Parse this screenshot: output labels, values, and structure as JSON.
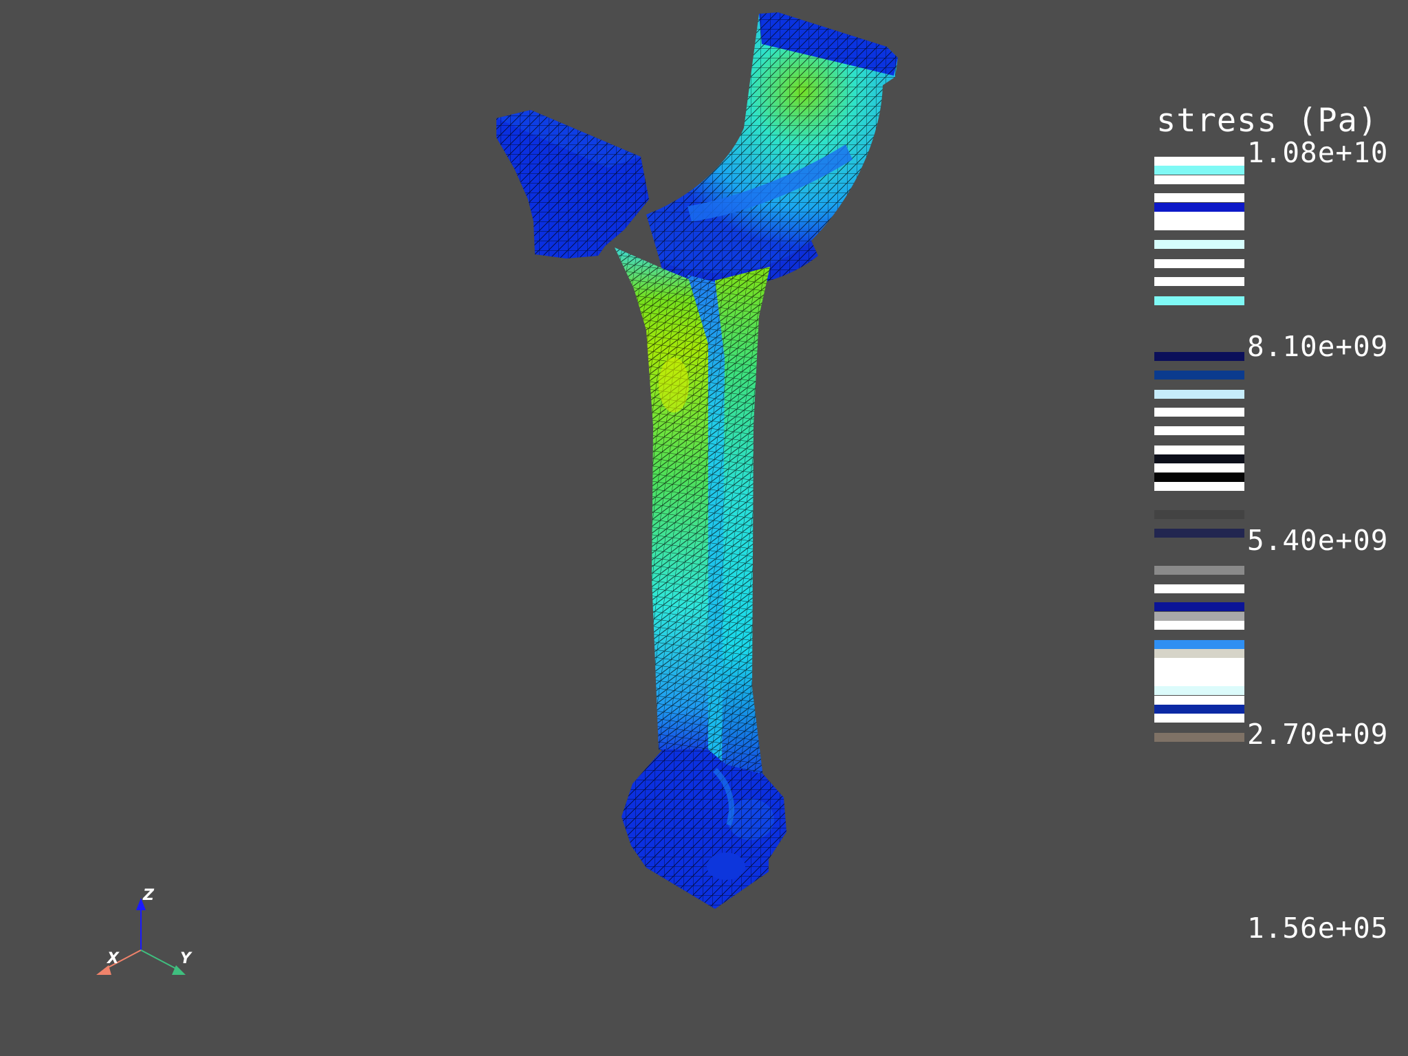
{
  "scalar_bar": {
    "title": "stress (Pa)",
    "labels": [
      "1.08e+10",
      "8.10e+09",
      "5.40e+09",
      "2.70e+09",
      "1.56e+05"
    ],
    "bands": [
      {
        "from": 0.0,
        "to": 0.012,
        "color": "#ffffff"
      },
      {
        "from": 0.012,
        "to": 0.024,
        "color": "#7ff9f5"
      },
      {
        "from": 0.024,
        "to": 0.036,
        "color": "#ffffff"
      },
      {
        "from": 0.048,
        "to": 0.06,
        "color": "#ffffff"
      },
      {
        "from": 0.06,
        "to": 0.072,
        "color": "#0d19c8"
      },
      {
        "from": 0.072,
        "to": 0.096,
        "color": "#ffffff"
      },
      {
        "from": 0.109,
        "to": 0.121,
        "color": "#d6fdfc"
      },
      {
        "from": 0.134,
        "to": 0.146,
        "color": "#ffffff"
      },
      {
        "from": 0.158,
        "to": 0.17,
        "color": "#ffffff"
      },
      {
        "from": 0.183,
        "to": 0.195,
        "color": "#7ff9f5"
      },
      {
        "from": 0.256,
        "to": 0.268,
        "color": "#0b0f5a"
      },
      {
        "from": 0.28,
        "to": 0.292,
        "color": "#0b3b8e"
      },
      {
        "from": 0.305,
        "to": 0.317,
        "color": "#c6ecfa"
      },
      {
        "from": 0.329,
        "to": 0.341,
        "color": "#ffffff"
      },
      {
        "from": 0.353,
        "to": 0.365,
        "color": "#ffffff"
      },
      {
        "from": 0.378,
        "to": 0.39,
        "color": "#ffffff"
      },
      {
        "from": 0.39,
        "to": 0.402,
        "color": "#0d0f1a"
      },
      {
        "from": 0.402,
        "to": 0.414,
        "color": "#ffffff"
      },
      {
        "from": 0.414,
        "to": 0.426,
        "color": "#050505"
      },
      {
        "from": 0.426,
        "to": 0.438,
        "color": "#ffffff"
      },
      {
        "from": 0.463,
        "to": 0.475,
        "color": "#434343"
      },
      {
        "from": 0.487,
        "to": 0.499,
        "color": "#222650"
      },
      {
        "from": 0.536,
        "to": 0.548,
        "color": "#8a8a8a"
      },
      {
        "from": 0.56,
        "to": 0.572,
        "color": "#ffffff"
      },
      {
        "from": 0.584,
        "to": 0.596,
        "color": "#0b1497"
      },
      {
        "from": 0.596,
        "to": 0.608,
        "color": "#a9a9a9"
      },
      {
        "from": 0.608,
        "to": 0.62,
        "color": "#ffffff"
      },
      {
        "from": 0.633,
        "to": 0.645,
        "color": "#2f8ff2"
      },
      {
        "from": 0.645,
        "to": 0.657,
        "color": "#d6d4c8"
      },
      {
        "from": 0.657,
        "to": 0.694,
        "color": "#ffffff"
      },
      {
        "from": 0.694,
        "to": 0.706,
        "color": "#dcfbfb"
      },
      {
        "from": 0.706,
        "to": 0.718,
        "color": "#ffffff"
      },
      {
        "from": 0.718,
        "to": 0.73,
        "color": "#0b29a4"
      },
      {
        "from": 0.73,
        "to": 0.742,
        "color": "#ffffff"
      },
      {
        "from": 0.755,
        "to": 0.767,
        "color": "#7f7266"
      }
    ]
  },
  "orientation_axes": {
    "labels": {
      "x": "X",
      "y": "Y",
      "z": "Z"
    },
    "colors": {
      "x": "#f0836b",
      "y": "#3fbf7f",
      "z": "#1a1aff"
    }
  },
  "colors": {
    "background": "#4d4d4d",
    "low": "#0a2be6",
    "mid": "#1ee8ee",
    "high": "#6fe000",
    "peak": "#c8ee00"
  }
}
